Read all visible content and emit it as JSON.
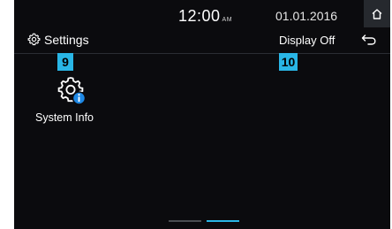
{
  "status": {
    "time": "12:00",
    "ampm": "AM",
    "date": "01.01.2016",
    "home_icon": "home-icon"
  },
  "header": {
    "title": "Settings",
    "title_icon": "gear-icon",
    "display_off_label": "Display Off",
    "back_icon": "back-arrow-icon"
  },
  "callouts": {
    "badge_system_info": "9",
    "badge_display_off": "10"
  },
  "main": {
    "items": [
      {
        "label": "System Info",
        "icon": "system-info-icon"
      }
    ]
  },
  "pagination": {
    "pages": 2,
    "active_index": 1
  },
  "colors": {
    "background": "#0b0b0e",
    "accent": "#29b6e6",
    "text": "#ffffff"
  }
}
